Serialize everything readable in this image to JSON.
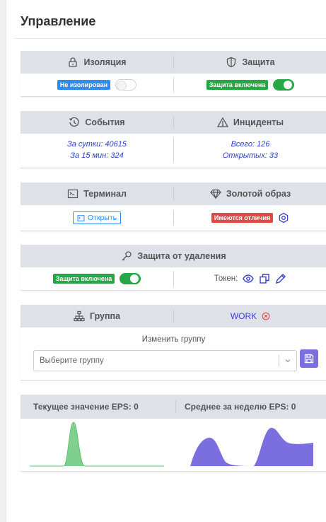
{
  "page": {
    "title": "Управление"
  },
  "isolation_card": {
    "left_header": "Изоляция",
    "right_header": "Защита",
    "isolation_status": "Не изолирован",
    "protection_status": "Защита включена",
    "isolation_toggle_on": false,
    "protection_toggle_on": true,
    "colors": {
      "blue_badge": "#2f8cf0",
      "green_badge": "#27a743"
    }
  },
  "events_card": {
    "left_header": "События",
    "right_header": "Инциденты",
    "day_events": "За сутки: 40615",
    "fifteen_min_events": "За 15 мин: 324",
    "total_incidents": "Всего: 126",
    "open_incidents": "Открытых: 33"
  },
  "terminal_card": {
    "left_header": "Терминал",
    "right_header": "Золотой образ",
    "open_button": "Открыть",
    "diff_badge": "Имеются отличия",
    "colors": {
      "red_badge": "#e04848"
    }
  },
  "deletion_card": {
    "header": "Защита от удаления",
    "status": "Защита включена",
    "toggle_on": true,
    "token_label": "Токен:"
  },
  "group_card": {
    "left_header": "Группа",
    "group_name": "WORK",
    "change_label": "Изменить группу",
    "select_placeholder": "Выберите группу"
  },
  "eps_card": {
    "current_label": "Текущее значение EPS: 0",
    "week_label": "Среднее за неделю EPS: 0",
    "colors": {
      "current": "#7fd08f",
      "week": "#7b6fe0"
    }
  }
}
